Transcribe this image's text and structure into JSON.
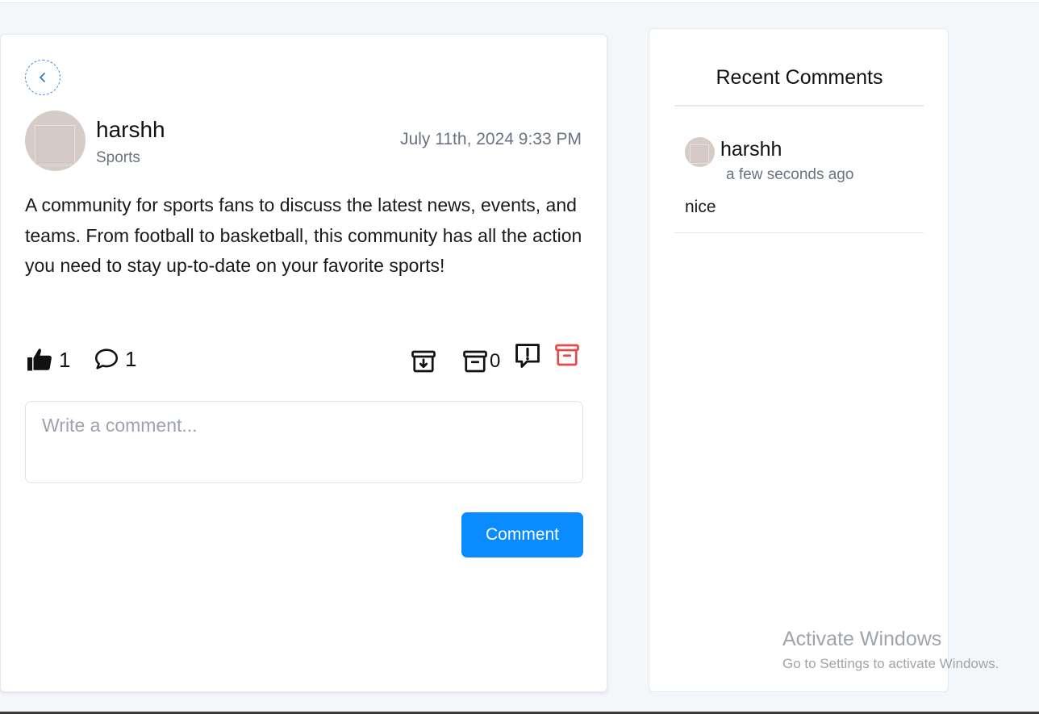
{
  "post": {
    "author": "harshh",
    "community": "Sports",
    "date": "July 11th, 2024 9:33 PM",
    "body": "A community for sports fans to discuss the latest news, events, and teams. From football to basketball, this community has all the action you need to stay up-to-date on your favorite sports!",
    "likes": "1",
    "comments": "1",
    "saves": "0"
  },
  "comment_form": {
    "placeholder": "Write a comment...",
    "submit_label": "Comment"
  },
  "recent_comments": {
    "title": "Recent Comments",
    "items": [
      {
        "user": "harshh",
        "time": "a few seconds ago",
        "text": "nice"
      }
    ]
  },
  "watermark": {
    "line1": "Activate Windows",
    "line2": "Go to Settings to activate Windows."
  },
  "colors": {
    "accent": "#0a8bff",
    "danger": "#e24b4b"
  }
}
